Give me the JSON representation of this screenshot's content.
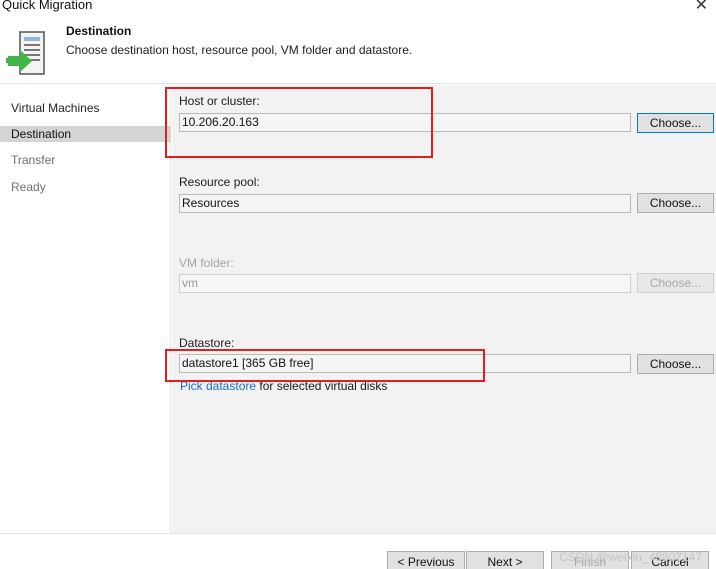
{
  "window": {
    "title": "Quick Migration",
    "close_glyph": "✕"
  },
  "header": {
    "title": "Destination",
    "description": "Choose destination host, resource pool, VM folder and datastore.",
    "icon": "migration-server-icon"
  },
  "steps": [
    {
      "label": "Virtual Machines",
      "state": "done"
    },
    {
      "label": "Destination",
      "state": "active"
    },
    {
      "label": "Transfer",
      "state": "future"
    },
    {
      "label": "Ready",
      "state": "future"
    }
  ],
  "fields": {
    "host": {
      "label": "Host or cluster:",
      "value": "10.206.20.163",
      "button": "Choose..."
    },
    "pool": {
      "label": "Resource pool:",
      "value": "Resources",
      "button": "Choose..."
    },
    "folder": {
      "label": "VM folder:",
      "value": "vm",
      "button": "Choose...",
      "enabled": false
    },
    "datastore": {
      "label": "Datastore:",
      "value": "datastore1 [365 GB free]",
      "button": "Choose..."
    }
  },
  "pick": {
    "link": "Pick datastore",
    "text": " for selected virtual disks"
  },
  "footer": {
    "previous": "< Previous",
    "next": "Next >",
    "finish": "Finish",
    "cancel": "Cancel",
    "watermark": "CSDN @weixin_48807147"
  },
  "colors": {
    "highlight": "#e02020",
    "link": "#1a6fd6",
    "active_step": "#d4d4d4",
    "icon_green": "#3fb54a"
  }
}
